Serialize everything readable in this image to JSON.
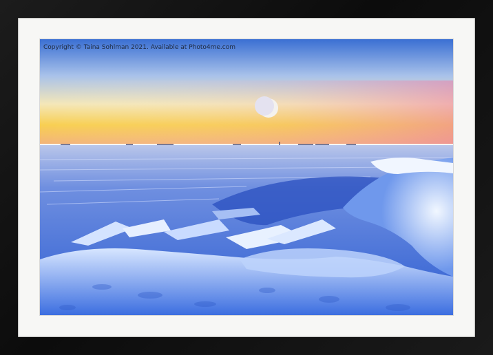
{
  "frame": {
    "color": "#111111",
    "mount_color": "#f7f7f5"
  },
  "photo": {
    "subject": "frozen sea at dusk with crescent moon",
    "credit_text": "Copyright © Taina Sohlman 2021. Available at Photo4me.com",
    "colors": {
      "sky_top": "#2f6fd6",
      "sky_mid": "#c9d8ee",
      "horizon_yellow": "#f7d24a",
      "horizon_pink": "#f08ca6",
      "ice": "#3f6fd8",
      "snow": "#e8f2ff"
    }
  }
}
